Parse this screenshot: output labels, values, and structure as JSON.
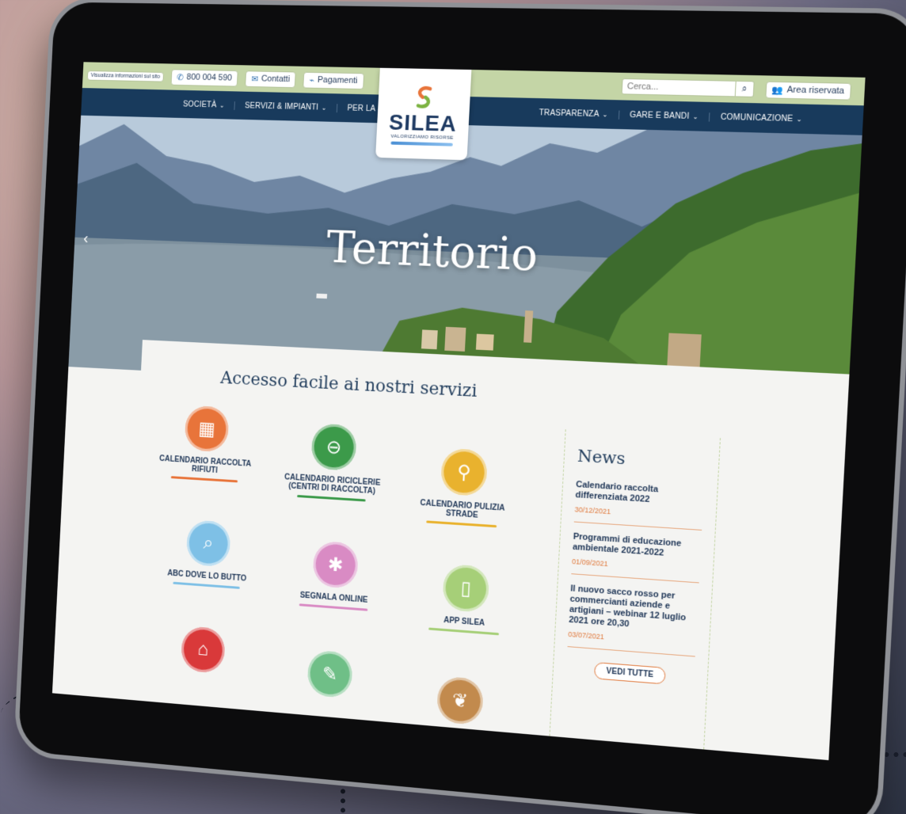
{
  "topbar": {
    "accessibility_label": "Visualizza informazioni sul sito",
    "phone": "800 004 590",
    "contacts": "Contatti",
    "payments": "Pagamenti",
    "search_placeholder": "Cerca...",
    "reserved_area": "Area riservata"
  },
  "logo": {
    "name": "SILEA",
    "tagline": "VALORIZZIAMO RISORSE"
  },
  "nav": {
    "left": [
      {
        "label": "SOCIETÀ"
      },
      {
        "label": "SERVIZI & IMPIANTI"
      },
      {
        "label": "PER LA SCUOLA"
      }
    ],
    "right": [
      {
        "label": "TRASPARENZA"
      },
      {
        "label": "GARE E BANDI"
      },
      {
        "label": "COMUNICAZIONE"
      }
    ]
  },
  "hero": {
    "title": "Territorio"
  },
  "services": {
    "title": "Accesso facile ai nostri servizi",
    "items": [
      {
        "label": "CALENDARIO RACCOLTA RIFIUTI",
        "color": "#e8743a",
        "icon": "calendar-icon"
      },
      {
        "label": "CALENDARIO RICICLERIE (CENTRI DI RACCOLTA)",
        "color": "#3c9a4a",
        "icon": "recycle-center-icon"
      },
      {
        "label": "CALENDARIO PULIZIA STRADE",
        "color": "#e9b22e",
        "icon": "street-sweeper-icon"
      },
      {
        "label": "ABC DOVE LO BUTTO",
        "color": "#7ec0e6",
        "icon": "magnifier-icon"
      },
      {
        "label": "SEGNALA ONLINE",
        "color": "#d98bc4",
        "icon": "report-icon"
      },
      {
        "label": "APP SILEA",
        "color": "#a6cf78",
        "icon": "phone-app-icon"
      },
      {
        "label": "",
        "color": "#d9393a",
        "icon": "shirt-icon"
      },
      {
        "label": "",
        "color": "#6fbf87",
        "icon": "pencil-icon"
      },
      {
        "label": "",
        "color": "#c28a4d",
        "icon": "leaf-icon"
      }
    ]
  },
  "news": {
    "title": "News",
    "items": [
      {
        "title": "Calendario raccolta differenziata 2022",
        "date": "30/12/2021"
      },
      {
        "title": "Programmi di educazione ambientale 2021-2022",
        "date": "01/09/2021"
      },
      {
        "title": "Il nuovo sacco rosso per commercianti aziende e artigiani – webinar 12 luglio 2021 ore 20,30",
        "date": "03/07/2021"
      }
    ],
    "see_all": "VEDI TUTTE"
  }
}
